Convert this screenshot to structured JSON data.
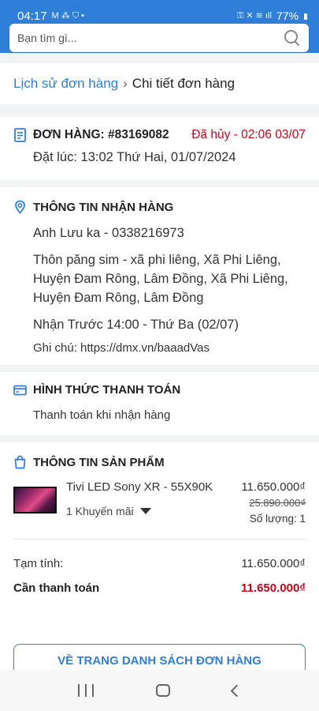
{
  "status_bar": {
    "time": "04:17",
    "battery": "77%"
  },
  "search": {
    "placeholder": "Bạn tìm gì..."
  },
  "breadcrumb": {
    "parent": "Lịch sử đơn hàng",
    "separator": "›",
    "current": "Chi tiết đơn hàng"
  },
  "order": {
    "title": "ĐƠN HÀNG: #83169082",
    "status": "Đã hủy - 02:06 03/07",
    "placed_at": "Đặt lúc: 13:02 Thứ Hai, 01/07/2024"
  },
  "receiver": {
    "heading": "THÔNG TIN NHẬN HÀNG",
    "name_phone": "Anh Lưu ka - 0338216973",
    "address": "Thôn păng sim - xã phi liêng, Xã Phi Liêng, Huyện Đam Rông, Lâm Đồng, Xã Phi Liêng, Huyện Đam Rông, Lâm Đồng",
    "delivery": "Nhận Trước 14:00 - Thứ Ba (02/07)",
    "note": "Ghi chú: https://dmx.vn/baaadVas"
  },
  "payment": {
    "heading": "HÌNH THỨC THANH TOÁN",
    "method": "Thanh toán khi nhận hàng"
  },
  "product": {
    "heading": "THÔNG TIN SẢN PHẨM",
    "name": "Tivi LED Sony XR - 55X90K",
    "promo": "1 Khuyến mãi",
    "price": "11.650.000₫",
    "old_price": "25.890.000₫",
    "quantity": "Số lượng: 1"
  },
  "summary": {
    "subtotal_label": "Tạm tính:",
    "subtotal_value": "11.650.000₫",
    "total_label": "Cần thanh toán",
    "total_value": "11.650.000₫"
  },
  "back_button": "VỀ TRANG DANH SÁCH ĐƠN HÀNG",
  "colors": {
    "primary": "#2f7fd9",
    "danger": "#d0021b"
  }
}
